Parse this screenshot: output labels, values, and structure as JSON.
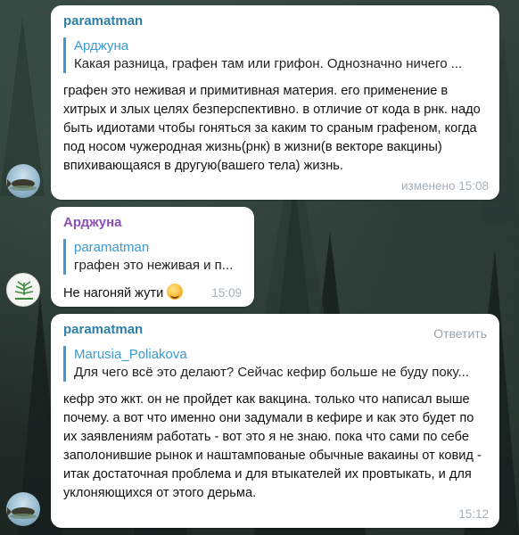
{
  "messages": [
    {
      "sender": "paramatman",
      "quote_author": "Арджуна",
      "quote_text": "Какая разница, графен там или грифон. Однозначно ничего ...",
      "text": "графен это неживая и примитивная материя. его применение в хитрых и злых целях безперспективно. в отличие от кода в рнк. надо быть идиотами чтобы гоняться за каким то сраным графеном, когда под носом чужеродная жизнь(рнк) в жизни(в векторе вакцины) впихивающаяся в другую(вашего тела) жизнь.",
      "time": "изменено 15:08",
      "avatar_icon": "fish-avatar-icon"
    },
    {
      "sender": "Арджуна",
      "quote_author": "paramatman",
      "quote_text": "графен это неживая и п...",
      "text": "Не нагоняй жути",
      "emoji": "🤪",
      "time": "15:09",
      "avatar_icon": "tree-logo-avatar-icon"
    },
    {
      "sender": "paramatman",
      "reply_label": "Ответить",
      "quote_author": "Marusia_Poliakova",
      "quote_text": "Для чего всё это делают? Сейчас кефир больше не буду поку...",
      "text": "кефр это жкт. он не пройдет как вакцина. только что написал выше почему. а вот что именно они задумали в кефире и как это будет по их заявлениям работать - вот это я не знаю. пока что сами по себе заполонившие рынок и наштампованые обычные вакаины от ковид - итак достаточная проблема и для втыкателей их провтыкать, и для уклоняющихся от этого дерьма.",
      "time": "15:12",
      "avatar_icon": "fish-avatar-icon"
    }
  ],
  "colors": {
    "sender_blue": "#2e7fa6",
    "sender_purple": "#8b4fb8",
    "quote_accent": "#3a9ad1",
    "bubble_bg": "#ffffff",
    "time_gray": "#a6b0b7"
  }
}
